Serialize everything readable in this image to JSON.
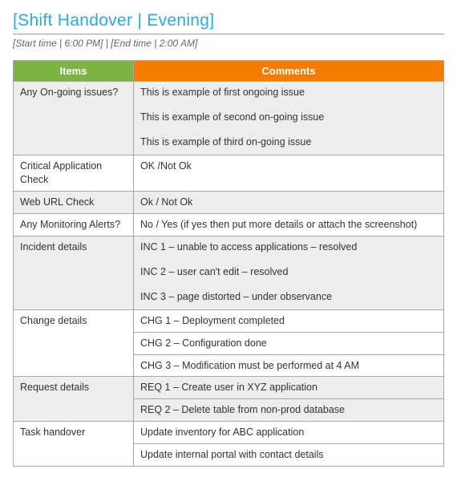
{
  "header": {
    "title": "[Shift Handover | Evening]",
    "subtitle": "[Start time | 6:00 PM] | [End time | 2:00 AM]"
  },
  "table": {
    "col_items": "Items",
    "col_comments": "Comments",
    "rows": {
      "ongoing": {
        "item": "Any On-going issues?",
        "c1": "This is example of first ongoing issue",
        "c2": "This is example of second on-going issue",
        "c3": "This is example of third on-going issue"
      },
      "critical": {
        "item": "Critical Application Check",
        "comment": "OK /Not Ok"
      },
      "weburl": {
        "item": "Web URL Check",
        "comment": "Ok / Not Ok"
      },
      "alerts": {
        "item": "Any Monitoring Alerts?",
        "comment": "No / Yes (if yes then put more details or attach the screenshot)"
      },
      "incident": {
        "item": "Incident details",
        "c1": "INC 1 – unable to access applications – resolved",
        "c2": "INC 2 – user can't edit – resolved",
        "c3": "INC 3 – page distorted – under observance"
      },
      "change": {
        "item": "Change details",
        "c1": "CHG 1 – Deployment completed",
        "c2": "CHG 2 – Configuration done",
        "c3": "CHG 3 – Modification must be performed at 4 AM"
      },
      "request": {
        "item": "Request details",
        "c1": "REQ 1 – Create user in XYZ application",
        "c2": "REQ 2 – Delete table from non-prod database"
      },
      "task": {
        "item": "Task handover",
        "c1": "Update inventory for ABC application",
        "c2": "Update internal portal with contact details"
      }
    }
  }
}
